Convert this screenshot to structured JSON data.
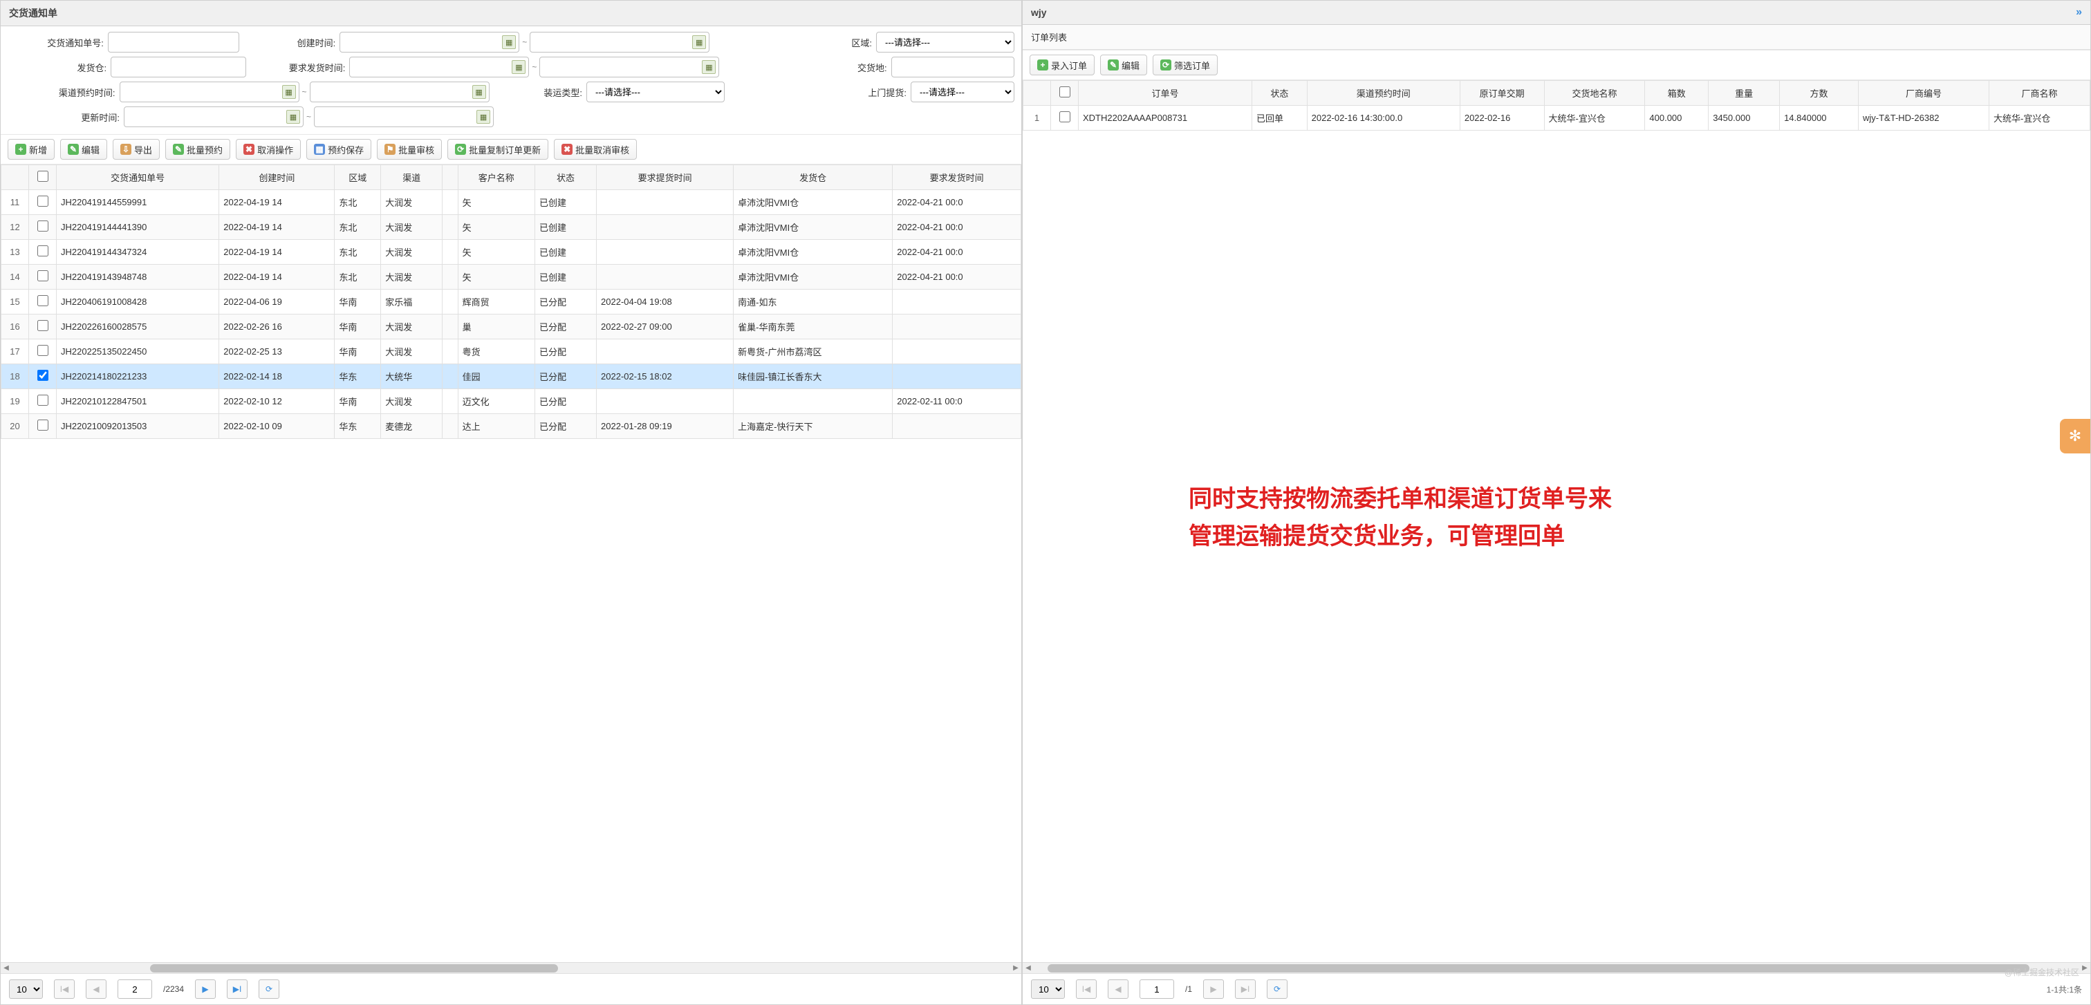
{
  "left": {
    "title": "交货通知单",
    "filters": {
      "notice_no": "交货通知单号:",
      "create_time": "创建时间:",
      "region": "区域:",
      "warehouse": "发货仓:",
      "req_ship_time": "要求发货时间:",
      "delivery_place": "交货地:",
      "channel_time": "渠道预约时间:",
      "load_type": "装运类型:",
      "door_pickup": "上门提货:",
      "update_time": "更新时间:",
      "please_select": "---请选择---"
    },
    "toolbar": {
      "add": "新增",
      "edit": "编辑",
      "export": "导出",
      "batch_book": "批量预约",
      "cancel_op": "取消操作",
      "book_save": "预约保存",
      "batch_audit": "批量审核",
      "batch_copy": "批量复制订单更新",
      "batch_unaudit": "批量取消审核"
    },
    "columns": [
      "",
      "",
      "交货通知单号",
      "创建时间",
      "区域",
      "渠道",
      "",
      "客户名称",
      "状态",
      "要求提货时间",
      "发货仓",
      "要求发货时间"
    ],
    "rows": [
      {
        "n": 11,
        "no": "JH220419144559991",
        "ct": "2022-04-19 14",
        "rg": "东北",
        "ch": "大润发",
        "cu": "",
        "cn": "矢",
        "st": "已创建",
        "rt": "",
        "wh": "卓沛沈阳VMI仓",
        "rs": "2022-04-21 00:0"
      },
      {
        "n": 12,
        "no": "JH220419144441390",
        "ct": "2022-04-19 14",
        "rg": "东北",
        "ch": "大润发",
        "cu": "",
        "cn": "矢",
        "st": "已创建",
        "rt": "",
        "wh": "卓沛沈阳VMI仓",
        "rs": "2022-04-21 00:0"
      },
      {
        "n": 13,
        "no": "JH220419144347324",
        "ct": "2022-04-19 14",
        "rg": "东北",
        "ch": "大润发",
        "cu": "",
        "cn": "矢",
        "st": "已创建",
        "rt": "",
        "wh": "卓沛沈阳VMI仓",
        "rs": "2022-04-21 00:0"
      },
      {
        "n": 14,
        "no": "JH220419143948748",
        "ct": "2022-04-19 14",
        "rg": "东北",
        "ch": "大润发",
        "cu": "",
        "cn": "矢",
        "st": "已创建",
        "rt": "",
        "wh": "卓沛沈阳VMI仓",
        "rs": "2022-04-21 00:0"
      },
      {
        "n": 15,
        "no": "JH220406191008428",
        "ct": "2022-04-06 19",
        "rg": "华南",
        "ch": "家乐福",
        "cu": "",
        "cn": "辉商贸",
        "st": "已分配",
        "rt": "2022-04-04 19:08",
        "wh": "南通-如东",
        "rs": ""
      },
      {
        "n": 16,
        "no": "JH220226160028575",
        "ct": "2022-02-26 16",
        "rg": "华南",
        "ch": "大润发",
        "cu": "",
        "cn": "巢",
        "st": "已分配",
        "rt": "2022-02-27 09:00",
        "wh": "雀巢-华南东莞",
        "rs": ""
      },
      {
        "n": 17,
        "no": "JH220225135022450",
        "ct": "2022-02-25 13",
        "rg": "华南",
        "ch": "大润发",
        "cu": "",
        "cn": "粤货",
        "st": "已分配",
        "rt": "",
        "wh": "新粤货-广州市荔湾区",
        "rs": ""
      },
      {
        "n": 18,
        "no": "JH220214180221233",
        "ct": "2022-02-14 18",
        "rg": "华东",
        "ch": "大统华",
        "cu": "",
        "cn": "佳园",
        "st": "已分配",
        "rt": "2022-02-15 18:02",
        "wh": "味佳园-镇江长香东大",
        "rs": "",
        "sel": true
      },
      {
        "n": 19,
        "no": "JH220210122847501",
        "ct": "2022-02-10 12",
        "rg": "华南",
        "ch": "大润发",
        "cu": "",
        "cn": "迈文化",
        "st": "已分配",
        "rt": "",
        "wh": "",
        "rs": "2022-02-11 00:0"
      },
      {
        "n": 20,
        "no": "JH220210092013503",
        "ct": "2022-02-10 09",
        "rg": "华东",
        "ch": "麦德龙",
        "cu": "",
        "cn": "达上",
        "st": "已分配",
        "rt": "2022-01-28 09:19",
        "wh": "上海嘉定-快行天下",
        "rs": ""
      }
    ],
    "pager": {
      "size": "10",
      "page": "2",
      "total": "/2234"
    }
  },
  "right": {
    "title": "wjy",
    "subtitle": "订单列表",
    "toolbar": {
      "enter": "录入订单",
      "edit": "编辑",
      "filter": "筛选订单"
    },
    "columns": [
      "",
      "",
      "订单号",
      "状态",
      "渠道预约时间",
      "原订单交期",
      "交货地名称",
      "箱数",
      "重量",
      "方数",
      "厂商编号",
      "厂商名称"
    ],
    "rows": [
      {
        "n": 1,
        "no": "XDTH2202AAAAP008731",
        "st": "已回单",
        "ct": "2022-02-16 14:30:00.0",
        "od": "2022-02-16",
        "dp": "大统华-宜兴仓",
        "bx": "400.000",
        "wt": "3450.000",
        "cb": "14.840000",
        "vc": "wjy-T&T-HD-26382",
        "vn": "大统华-宜兴仓"
      }
    ],
    "pager": {
      "size": "10",
      "page": "1",
      "total": "/1",
      "summary": "1-1共:1条"
    },
    "annotation1": "同时支持按物流委托单和渠道订货单号来",
    "annotation2": "管理运输提货交货业务，可管理回单",
    "watermark": "@稀土掘金技术社区"
  }
}
